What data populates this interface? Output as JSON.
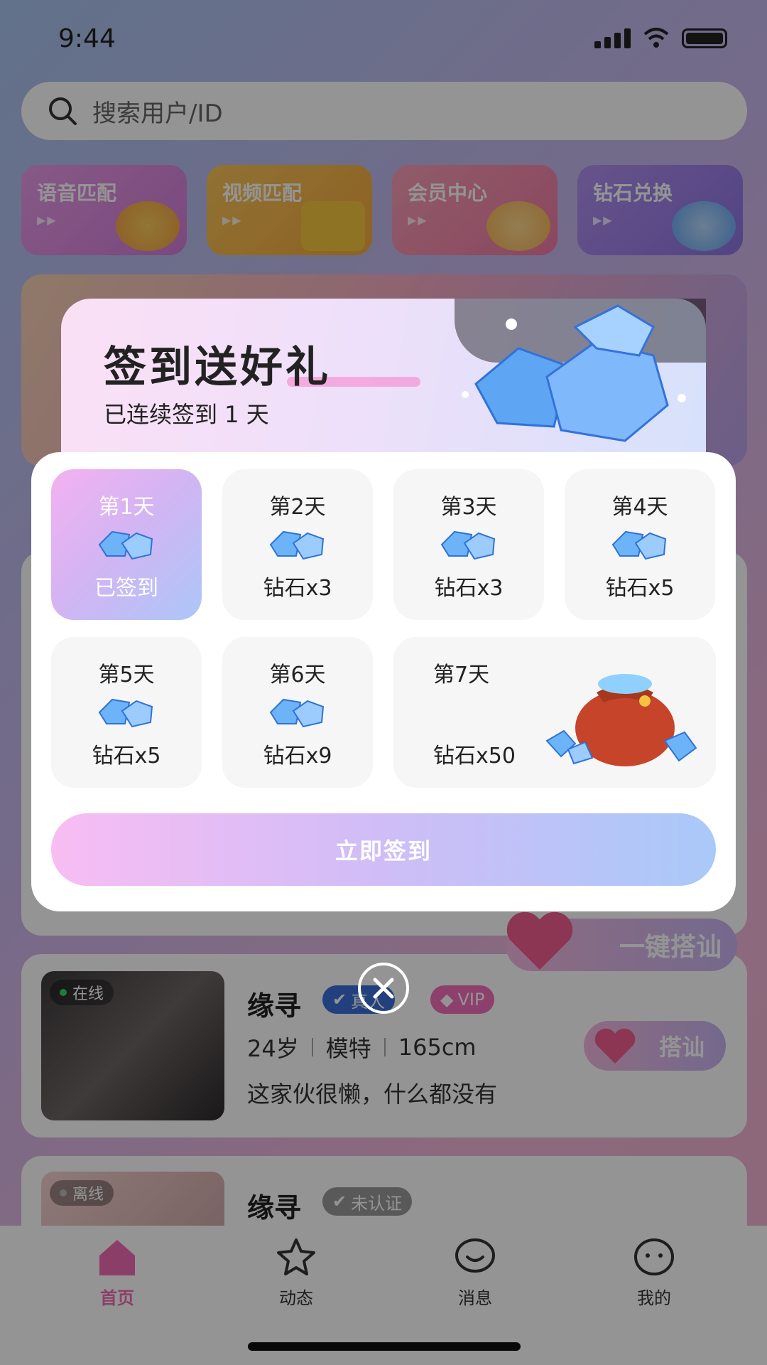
{
  "status": {
    "time": "9:44"
  },
  "search": {
    "placeholder": "搜索用户/ID"
  },
  "quick_entries": [
    {
      "label": "语音匹配",
      "arrows": "▶▶"
    },
    {
      "label": "视频匹配",
      "arrows": "▶▶"
    },
    {
      "label": "会员中心",
      "arrows": "▶▶"
    },
    {
      "label": "钻石兑换",
      "arrows": "▶▶"
    }
  ],
  "cards": [
    {
      "status": "在线",
      "name": "缘寻",
      "badge_verified": "真人",
      "badge_vip": "VIP",
      "age": "24岁",
      "job": "模特",
      "height": "165cm",
      "bio": "这家伙很懒，什么都没有",
      "action": "搭讪"
    },
    {
      "status": "离线",
      "name": "缘寻",
      "badge_unverified": "未认证"
    }
  ],
  "one_key_chat": "一键搭讪",
  "tabs": [
    {
      "label": "首页"
    },
    {
      "label": "动态"
    },
    {
      "label": "消息"
    },
    {
      "label": "我的"
    }
  ],
  "modal": {
    "title": "签到送好礼",
    "subtitle": "已连续签到 1 天",
    "days": [
      {
        "label": "第1天",
        "reward": "已签到"
      },
      {
        "label": "第2天",
        "reward": "钻石x3"
      },
      {
        "label": "第3天",
        "reward": "钻石x3"
      },
      {
        "label": "第4天",
        "reward": "钻石x5"
      },
      {
        "label": "第5天",
        "reward": "钻石x5"
      },
      {
        "label": "第6天",
        "reward": "钻石x9"
      },
      {
        "label": "第7天",
        "reward": "钻石x50"
      }
    ],
    "button": "立即签到"
  },
  "colors": {
    "accent_pink": "#f3b1f1",
    "accent_blue": "#acc7f8",
    "verified_blue": "#3b6fd9",
    "vip_pink": "#f26fb8",
    "home_tab": "#f06db3"
  }
}
